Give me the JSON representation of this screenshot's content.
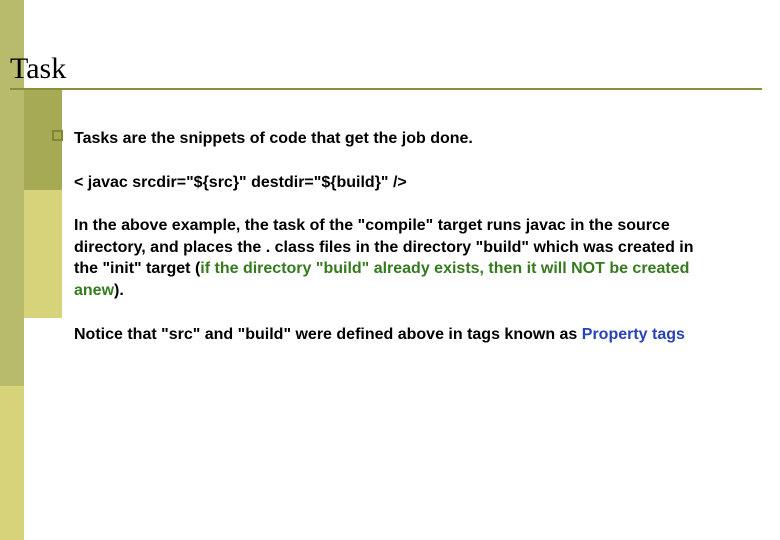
{
  "title": "Task",
  "p1": "Tasks are the snippets of code that get the job done.",
  "p2": "< javac srcdir=\"${src}\" destdir=\"${build}\" />",
  "p3_a": "In the above example, the task of the \"compile\" target runs javac in the source directory,  and places the . class files in the directory \"build\" which was created in the \"init\"  target (",
  "p3_green": "if the directory \"build\" already exists, then it will NOT be created anew",
  "p3_c": ").",
  "p4_a": "Notice that \"src\" and \"build\" were defined above in tags known as ",
  "p4_link": "Property tags"
}
